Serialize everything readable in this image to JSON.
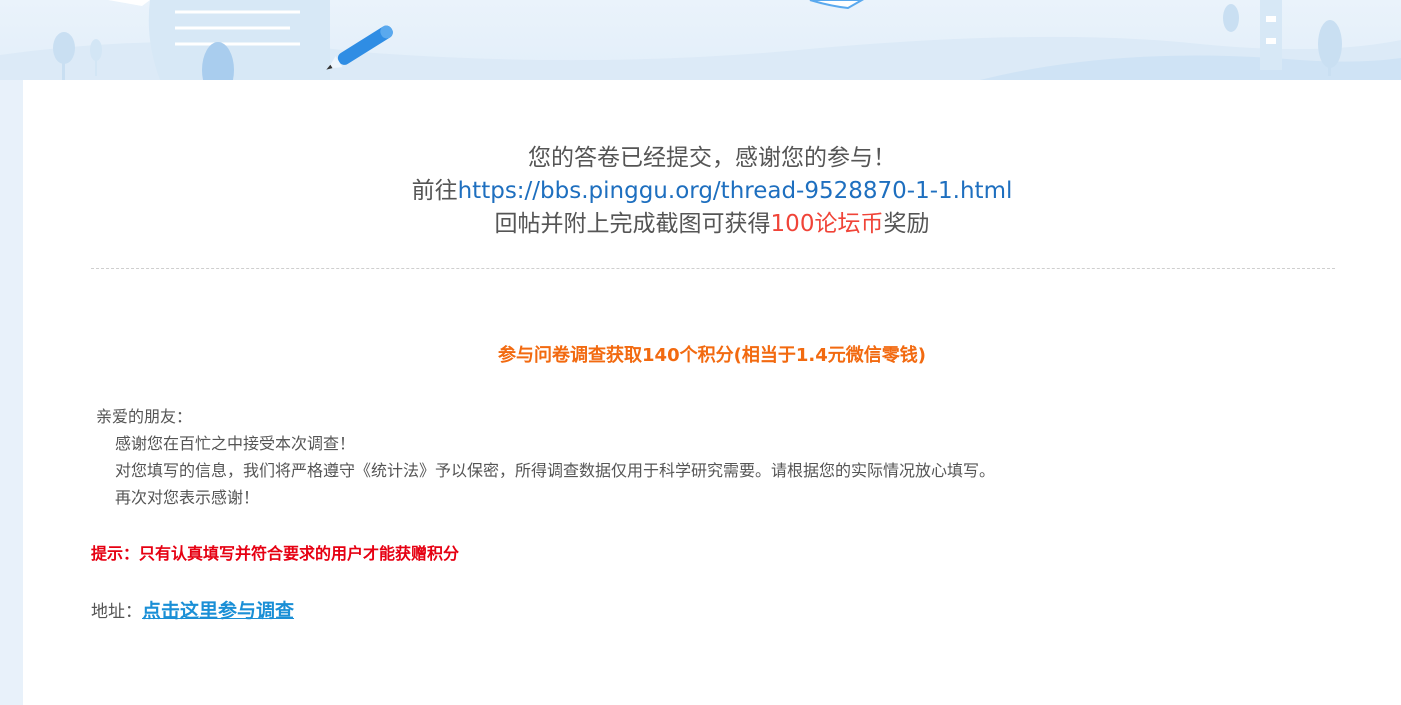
{
  "success": {
    "line1": "您的答卷已经提交，感谢您的参与！",
    "line2_prefix": "前往",
    "line2_link": "https://bbs.pinggu.org/thread-9528870-1-1.html",
    "line3_prefix": "回帖并附上完成截图可获得",
    "line3_reward": "100论坛币",
    "line3_suffix": "奖励"
  },
  "survey": {
    "title": "参与问卷调查获取140个积分(相当于1.4元微信零钱)"
  },
  "letter": {
    "greeting": "亲爱的朋友：",
    "lines": [
      "感谢您在百忙之中接受本次调查！",
      "对您填写的信息，我们将严格遵守《统计法》予以保密，所得调查数据仅用于科学研究需要。请根据您的实际情况放心填写。",
      "再次对您表示感谢！"
    ]
  },
  "tip": {
    "text": "提示：只有认真填写并符合要求的用户才能获赠积分"
  },
  "address": {
    "label": "地址：",
    "link_text": "点击这里参与调查"
  },
  "colors": {
    "link_blue": "#1e6fbf",
    "reward_red": "#f04438",
    "title_orange": "#f26a10",
    "tip_red": "#e60012",
    "survey_link": "#1a8fd6"
  },
  "icons": [
    "pen-icon",
    "document-illustration"
  ]
}
